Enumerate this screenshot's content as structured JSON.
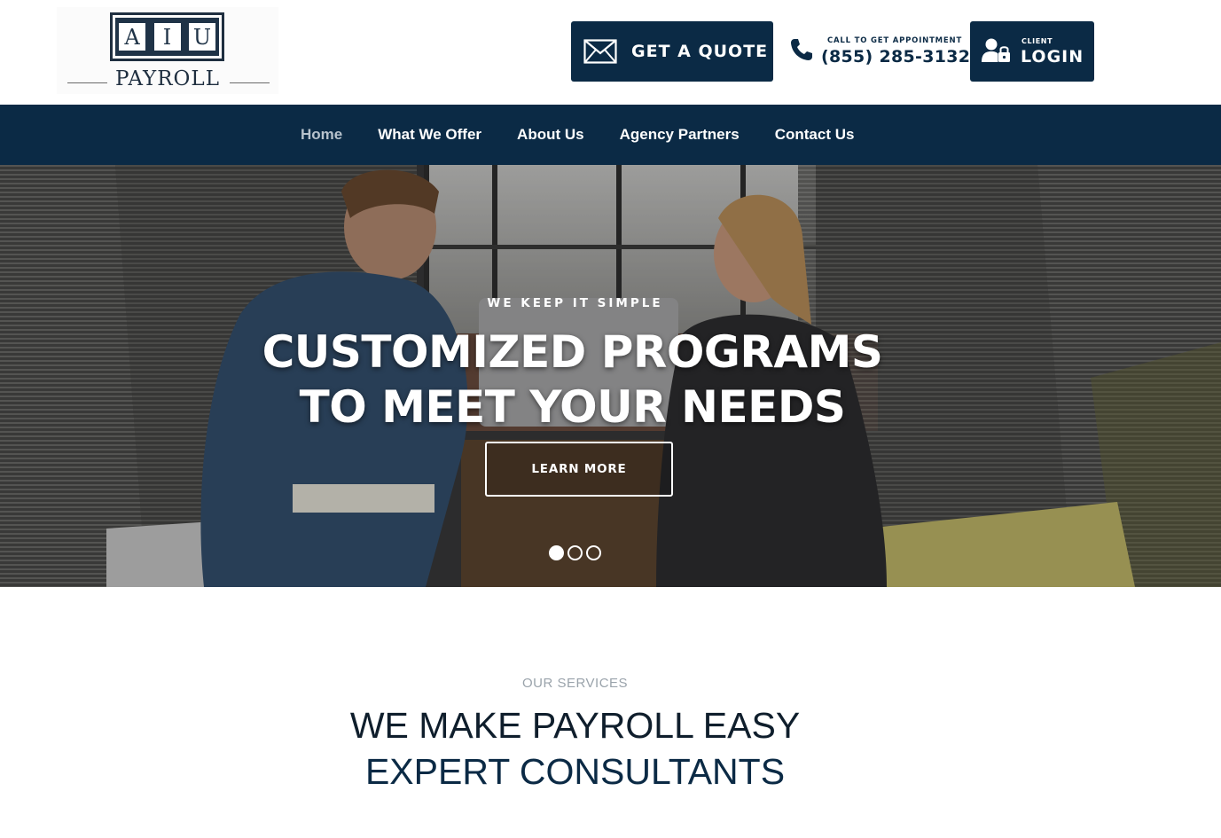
{
  "header": {
    "logo": {
      "letters": [
        "A",
        "I",
        "U"
      ],
      "word": "PAYROLL"
    },
    "quote_label": "GET A QUOTE",
    "call_small": "CALL TO GET APPOINTMENT",
    "call_number": "(855) 285-3132",
    "login_small": "CLIENT",
    "login_label": "LOGIN"
  },
  "nav": {
    "items": [
      {
        "label": "Home",
        "active": true
      },
      {
        "label": "What We Offer"
      },
      {
        "label": "About Us"
      },
      {
        "label": "Agency Partners"
      },
      {
        "label": "Contact Us"
      }
    ]
  },
  "hero": {
    "eyebrow": "WE KEEP IT SIMPLE",
    "title_line1": "CUSTOMIZED PROGRAMS",
    "title_line2": "TO MEET YOUR NEEDS",
    "button_label": "LEARN MORE",
    "slides_total": 3,
    "active_slide": 1
  },
  "services": {
    "eyebrow": "OUR SERVICES",
    "title": "WE MAKE PAYROLL EASY",
    "subtitle": "EXPERT CONSULTANTS"
  },
  "colors": {
    "brand_navy": "#0b2a45",
    "nav_active": "#b7c2cc",
    "muted_gray": "#9aa3ab"
  },
  "icons": [
    "envelope-icon",
    "phone-icon",
    "user-lock-icon"
  ]
}
